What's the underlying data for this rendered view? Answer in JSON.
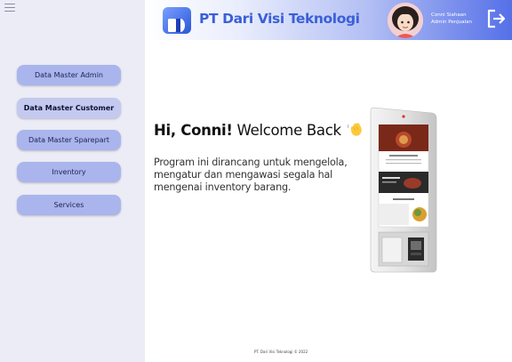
{
  "sidebar": {
    "items": [
      {
        "label": "Data Master Admin"
      },
      {
        "label": "Data Master Customer"
      },
      {
        "label": "Data Master Sparepart"
      },
      {
        "label": "Inventory"
      },
      {
        "label": "Services"
      }
    ]
  },
  "header": {
    "brand": "PT Dari Visi Teknologi",
    "user_name": "Conni Siahaan",
    "user_role": "Admin Penjualan"
  },
  "main": {
    "greeting_hi": "Hi, Conni!",
    "greeting_rest": " Welcome Back",
    "description": "Program ini dirancang untuk mengelola, mengatur dan mengawasi segala hal mengenai inventory barang."
  },
  "footer": {
    "text": "PT. Dari Visi Teknologi © 2022"
  },
  "icons": {
    "menu": "hamburger-icon",
    "logo": "brand-logo",
    "logout": "logout-icon",
    "wave": "waving-hand-icon"
  },
  "colors": {
    "nav_button": "#a9b5ec",
    "nav_button_active": "#c4c9f0",
    "brand_text": "#3b5fd8",
    "header_gradient_end": "#5570e8",
    "sidebar_bg": "#ececf6"
  }
}
